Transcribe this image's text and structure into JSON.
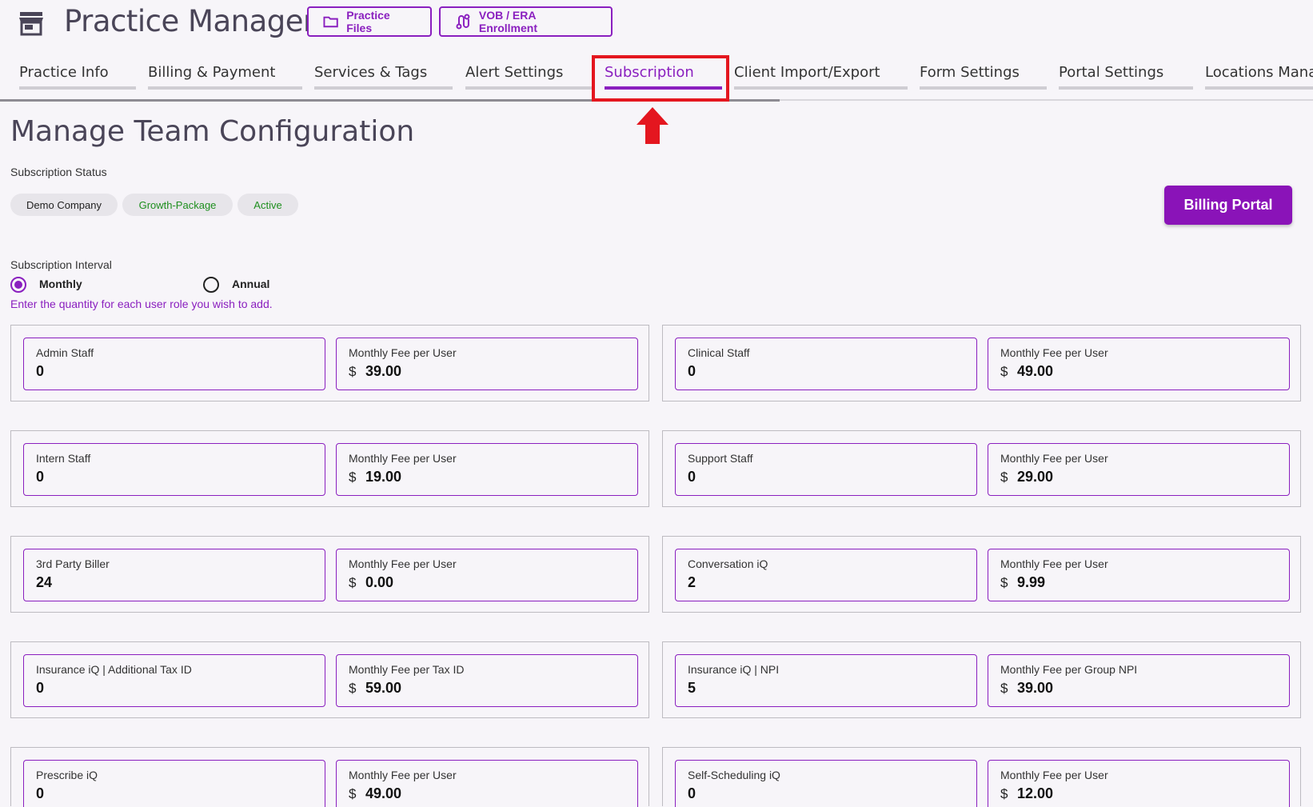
{
  "header": {
    "app_title": "Practice Manager",
    "practice_files_label": "Practice Files",
    "vob_label": "VOB / ERA Enrollment"
  },
  "tabs": [
    {
      "label": "Practice Info"
    },
    {
      "label": "Billing & Payment"
    },
    {
      "label": "Services & Tags"
    },
    {
      "label": "Alert Settings"
    },
    {
      "label": "Subscription",
      "active": true
    },
    {
      "label": "Client Import/Export"
    },
    {
      "label": "Form Settings"
    },
    {
      "label": "Portal Settings"
    },
    {
      "label": "Locations Manag"
    }
  ],
  "main": {
    "title": "Manage Team Configuration",
    "subscription_status_label": "Subscription Status",
    "chips": [
      "Demo Company",
      "Growth-Package",
      "Active"
    ],
    "billing_portal_label": "Billing Portal",
    "interval_label": "Subscription Interval",
    "interval_options": [
      "Monthly",
      "Annual"
    ],
    "interval_selected": "Monthly",
    "hint": "Enter the quantity for each user role you wish to add."
  },
  "currency_symbol": "$",
  "roles": [
    {
      "role": "Admin Staff",
      "qty": "0",
      "fee_label": "Monthly Fee per User",
      "fee": "39.00"
    },
    {
      "role": "Clinical Staff",
      "qty": "0",
      "fee_label": "Monthly Fee per User",
      "fee": "49.00"
    },
    {
      "role": "Intern Staff",
      "qty": "0",
      "fee_label": "Monthly Fee per User",
      "fee": "19.00"
    },
    {
      "role": "Support Staff",
      "qty": "0",
      "fee_label": "Monthly Fee per User",
      "fee": "29.00"
    },
    {
      "role": "3rd Party Biller",
      "qty": "24",
      "fee_label": "Monthly Fee per User",
      "fee": "0.00"
    },
    {
      "role": "Conversation iQ",
      "qty": "2",
      "fee_label": "Monthly Fee per User",
      "fee": "9.99"
    },
    {
      "role": "Insurance iQ | Additional Tax ID",
      "qty": "0",
      "fee_label": "Monthly Fee per Tax ID",
      "fee": "59.00"
    },
    {
      "role": "Insurance iQ | NPI",
      "qty": "5",
      "fee_label": "Monthly Fee per Group NPI",
      "fee": "39.00"
    },
    {
      "role": "Prescribe iQ",
      "qty": "0",
      "fee_label": "Monthly Fee per User",
      "fee": "49.00"
    },
    {
      "role": "Self-Scheduling iQ",
      "qty": "0",
      "fee_label": "Monthly Fee per User",
      "fee": "12.00"
    }
  ],
  "colors": {
    "accent": "#8a1fbf",
    "highlight": "#e4161f",
    "chip_green": "#1e8f1e"
  },
  "icons": [
    "store-icon",
    "folder-icon",
    "route-icon",
    "red-up-arrow-icon"
  ]
}
